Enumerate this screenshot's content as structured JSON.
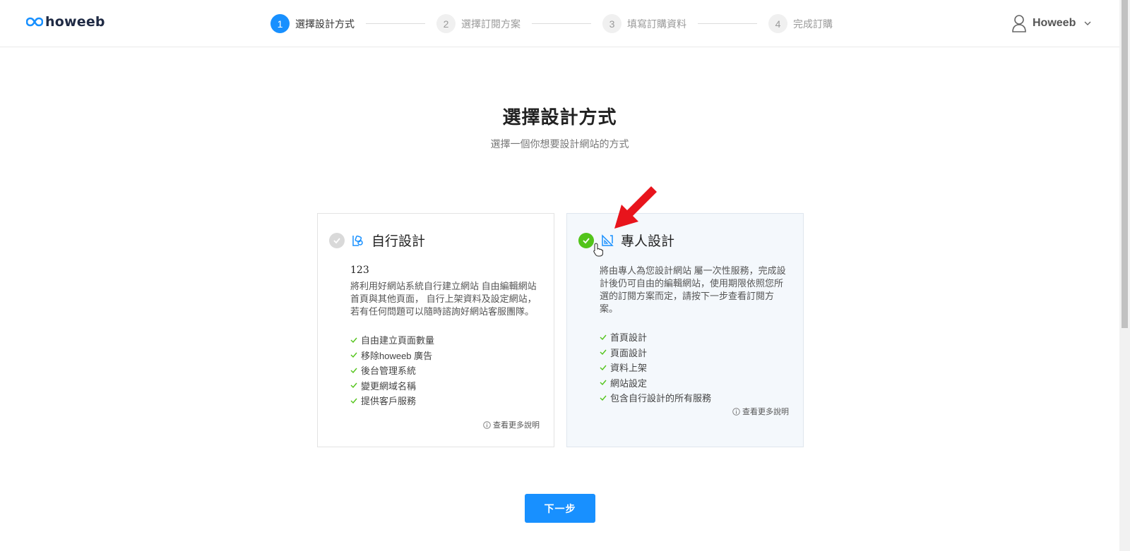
{
  "brand": {
    "name": "howeeb",
    "color": "#1f2a44",
    "accent": "#1890ff"
  },
  "steps": [
    {
      "num": "1",
      "label": "選擇設計方式",
      "active": true
    },
    {
      "num": "2",
      "label": "選擇訂閱方案",
      "active": false
    },
    {
      "num": "3",
      "label": "填寫訂購資料",
      "active": false
    },
    {
      "num": "4",
      "label": "完成訂購",
      "active": false
    }
  ],
  "user": {
    "name": "Howeeb",
    "icon": "user-icon",
    "menu_icon": "chevron-down-icon"
  },
  "main": {
    "title": "選擇設計方式",
    "subtitle": "選擇一個你想要設計網站的方式"
  },
  "cards": {
    "self": {
      "title": "自行設計",
      "selected": false,
      "icon": "self-design-icon",
      "tag": "123",
      "description": "將利用好網站系統自行建立網站 自由編輯網站首頁與其他頁面， 自行上架資料及設定網站，若有任何問題可以隨時諮詢好網站客服團隊。",
      "features": [
        "自由建立頁面數量",
        "移除howeeb 廣告",
        "後台管理系統",
        "變更網域名稱",
        "提供客戶服務"
      ],
      "more": "查看更多說明"
    },
    "pro": {
      "title": "專人設計",
      "selected": true,
      "icon": "pro-design-icon",
      "description": "將由專人為您設計網站 屬一次性服務，完成設計後仍可自由的編輯網站，使用期限依照您所選的訂閱方案而定，請按下一步查看訂閱方案。",
      "features": [
        "首頁設計",
        "頁面設計",
        "資料上架",
        "網站設定",
        "包含自行設計的所有服務"
      ],
      "more": "查看更多說明"
    }
  },
  "next_button": "下一步",
  "colors": {
    "selected_check": "#52c41a",
    "unselected_check": "#d9d9d9",
    "annotation_arrow": "#e8141c"
  }
}
